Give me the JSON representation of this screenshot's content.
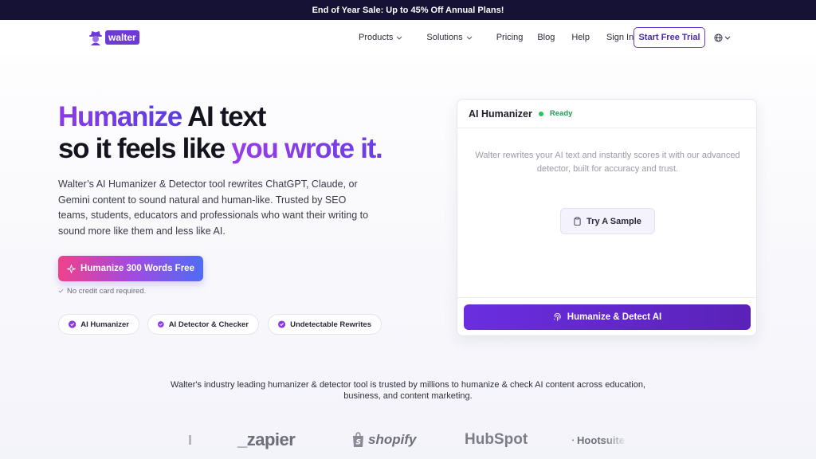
{
  "banner": {
    "text": "End of Year Sale: Up to 45% Off Annual Plans!"
  },
  "nav": {
    "logo_text": "walter",
    "links": [
      {
        "label": "Products",
        "dropdown": true
      },
      {
        "label": "Solutions",
        "dropdown": true
      },
      {
        "label": "Pricing",
        "dropdown": false
      },
      {
        "label": "Blog",
        "dropdown": false
      },
      {
        "label": "Help",
        "dropdown": false
      },
      {
        "label": "Sign In",
        "dropdown": false
      }
    ],
    "trial_label": "Start Free Trial",
    "language_icon": "globe-icon"
  },
  "hero": {
    "title_1a": "Humanize",
    "title_1b": "AI text",
    "title_2a": "so it feels like",
    "title_2b": "you wrote it.",
    "description": "Walter’s AI Humanizer & Detector tool rewrites ChatGPT, Claude, or Gemini content to sound natural and human-like. Trusted by SEO teams, students, educators and professionals who want their writing to sound more like them and less like AI.",
    "cta_label": "Humanize 300 Words Free",
    "no_card": "No credit card required.",
    "pills": [
      "AI Humanizer",
      "AI Detector & Checker",
      "Undetectable Rewrites"
    ]
  },
  "card": {
    "title": "AI Humanizer",
    "status": "Ready",
    "description": "Walter rewrites your AI text and instantly scores it with our advanced detector, built for accuracy and trust.",
    "sample_label": "Try A Sample",
    "detect_label": "Humanize & Detect AI"
  },
  "trust": {
    "text": "Walter's industry leading humanizer & detector tool is trusted by millions to humanize & check AI content across education, business, and content marketing."
  },
  "logos": [
    "_zapier",
    "shopify",
    "HubSpot",
    "Hootsuite"
  ],
  "colors": {
    "brand_purple": "#6d3ad6",
    "banner_bg": "#151236",
    "ready_green": "#22c55e"
  }
}
